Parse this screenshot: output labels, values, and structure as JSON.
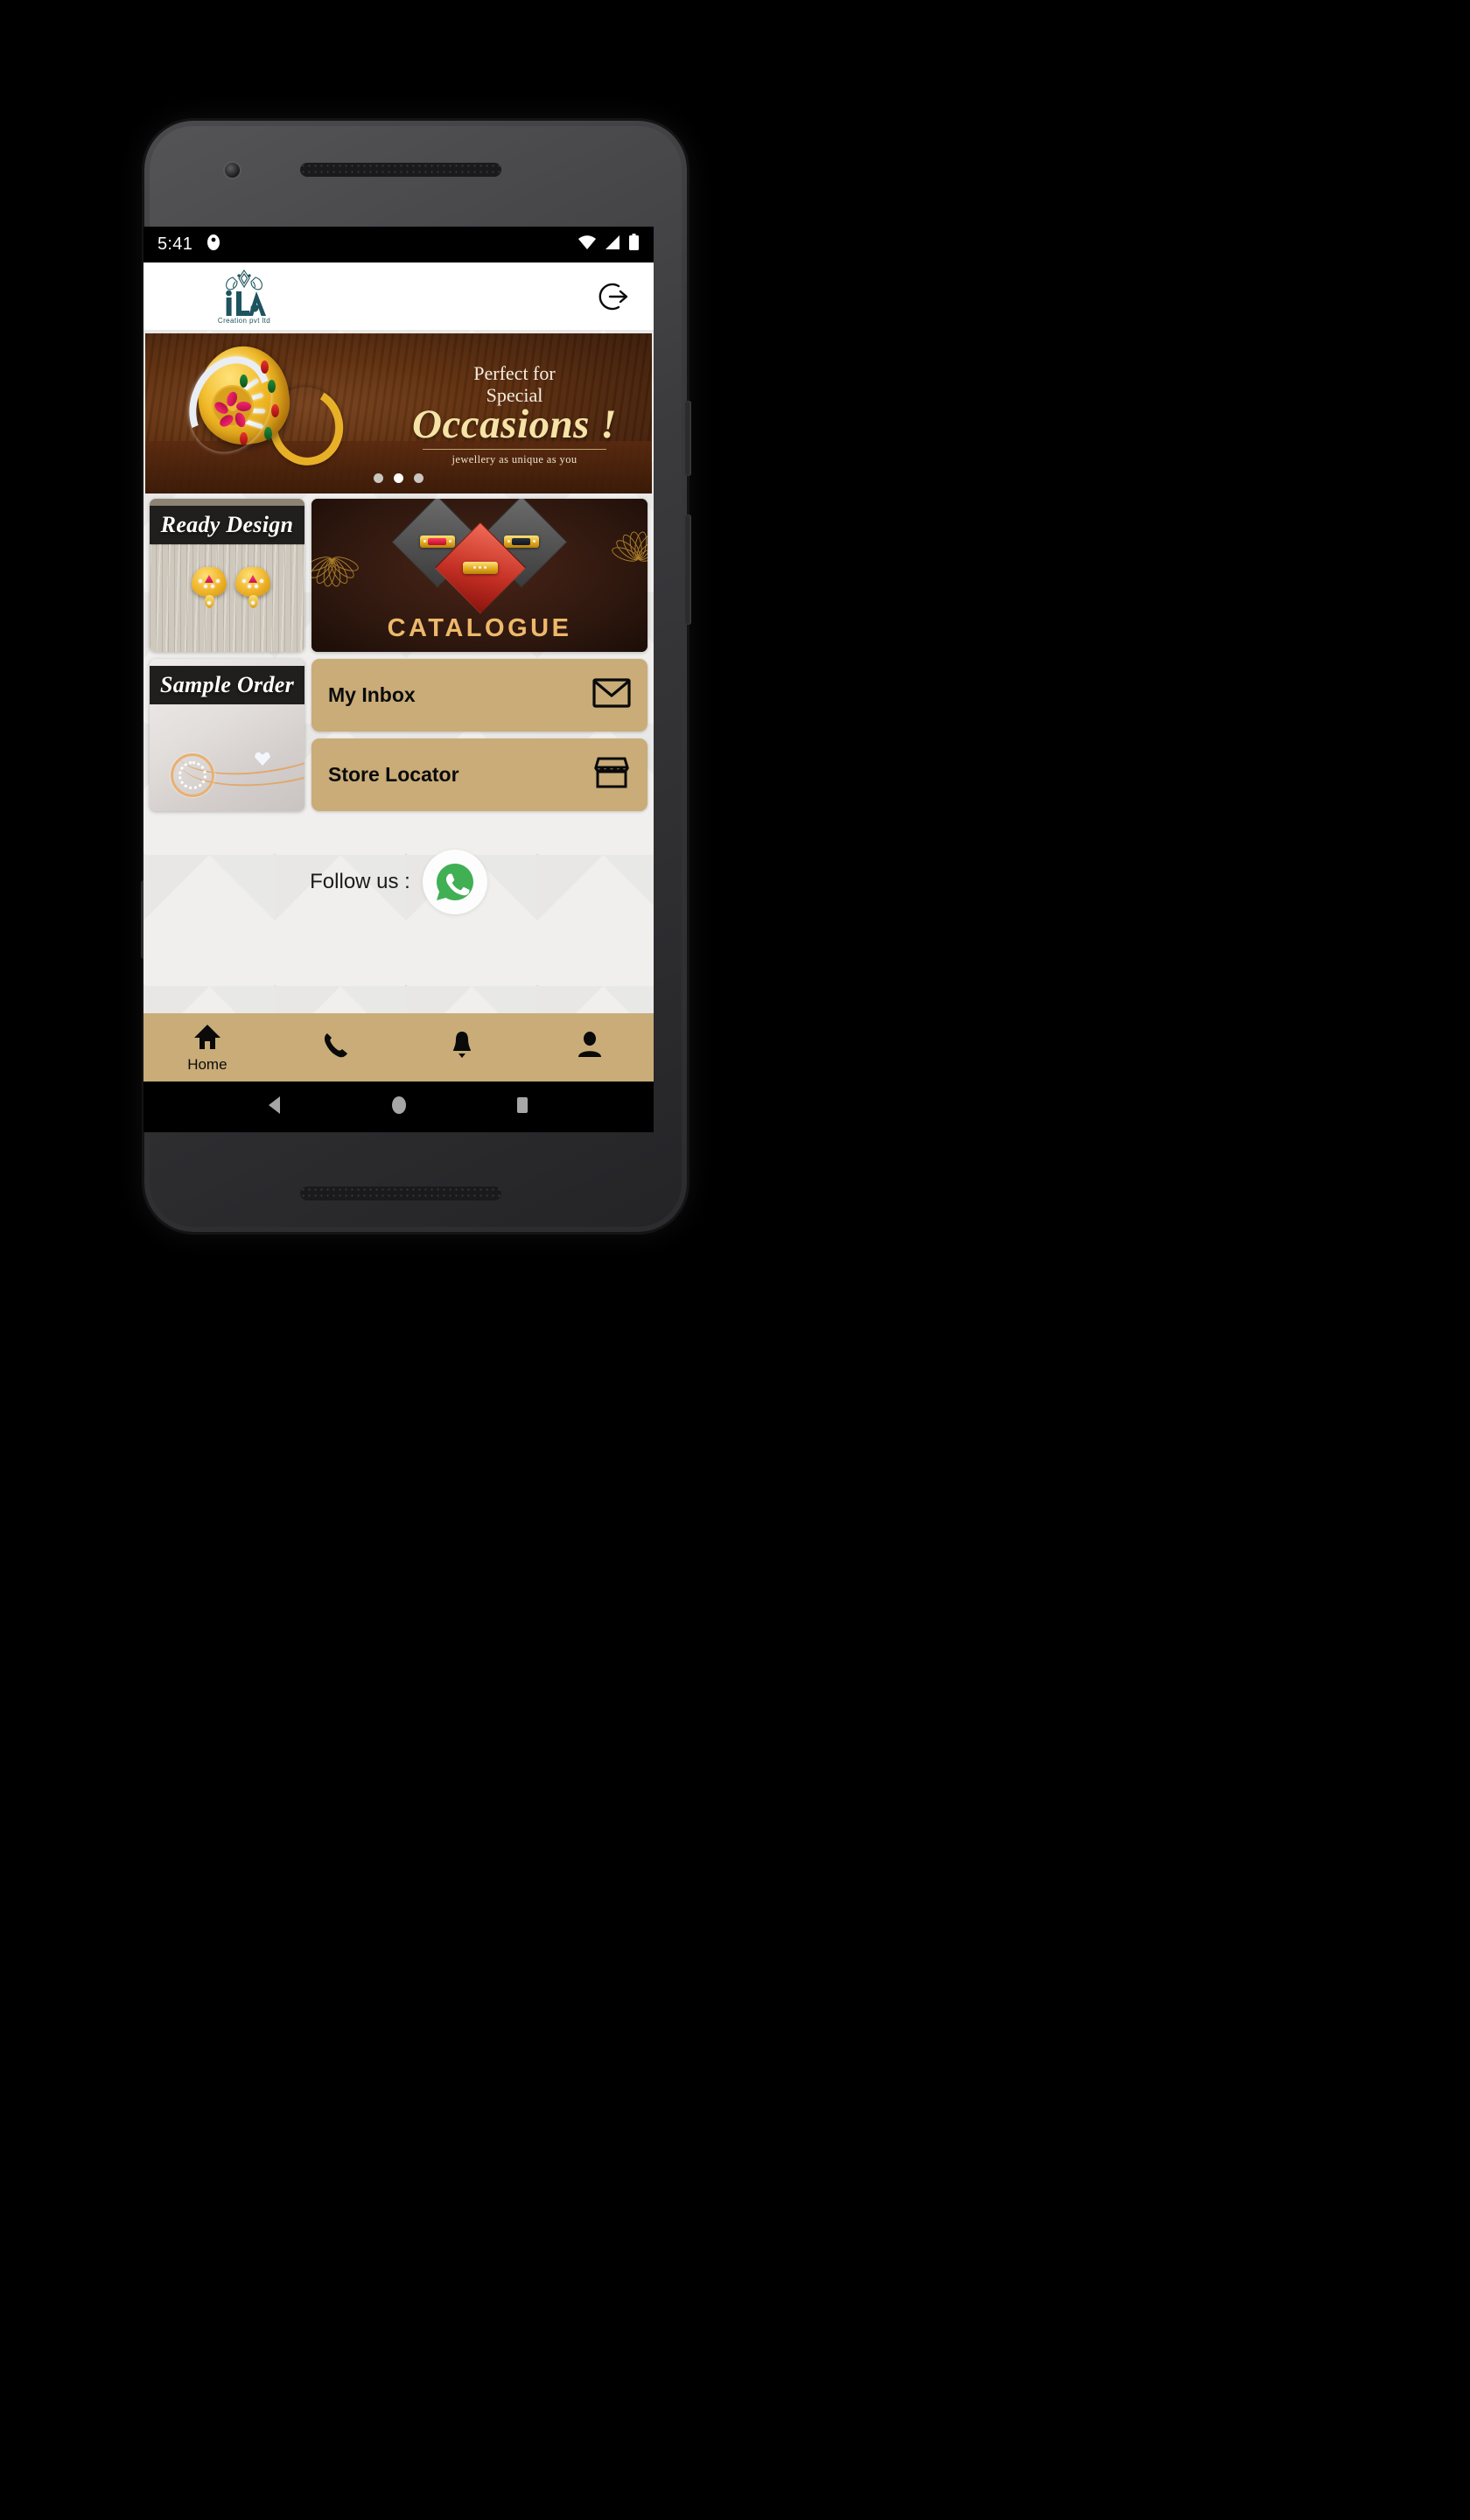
{
  "status_bar": {
    "clock": "5:41",
    "notification_icon": "app-notification-icon",
    "wifi_icon": "wifi-icon",
    "signal_icon": "cellular-signal-icon",
    "battery_icon": "battery-icon"
  },
  "app_bar": {
    "logo_text": "iLA",
    "logo_subtitle": "Creation pvt ltd",
    "logo_color": "#1d545f",
    "logout_icon": "logout-icon"
  },
  "hero": {
    "line1": "Perfect for",
    "line2": "Special",
    "headline": "Occasions !",
    "tagline": "jewellery as unique as you",
    "image_alt": "gold-ring-with-ruby-flower",
    "dots": [
      {
        "active": false
      },
      {
        "active": true
      },
      {
        "active": false
      }
    ]
  },
  "tiles": {
    "ready_design": {
      "label": "Ready Design",
      "image_alt": "gold-earrings-on-wood"
    },
    "catalogue": {
      "label": "CATALOGUE",
      "image_alt": "gold-rings-diamond-collage",
      "label_color": "#edb96a"
    },
    "sample_order": {
      "label": "Sample Order",
      "image_alt": "gold-necklace-pendant"
    }
  },
  "actions": [
    {
      "label": "My Inbox",
      "icon": "envelope-icon"
    },
    {
      "label": "Store Locator",
      "icon": "storefront-icon"
    }
  ],
  "follow": {
    "text": "Follow us :",
    "whatsapp_icon": "whatsapp-icon",
    "whatsapp_color": "#41AF54"
  },
  "bottom_nav": {
    "background": "#c9ac78",
    "items": [
      {
        "label": "Home",
        "icon": "home-icon",
        "active": true
      },
      {
        "label": "",
        "icon": "phone-icon",
        "active": false
      },
      {
        "label": "",
        "icon": "bell-icon",
        "active": false
      },
      {
        "label": "",
        "icon": "person-icon",
        "active": false
      }
    ]
  },
  "android_nav": {
    "back_icon": "back-triangle-icon",
    "home_icon": "home-circle-icon",
    "recents_icon": "recents-square-icon"
  }
}
